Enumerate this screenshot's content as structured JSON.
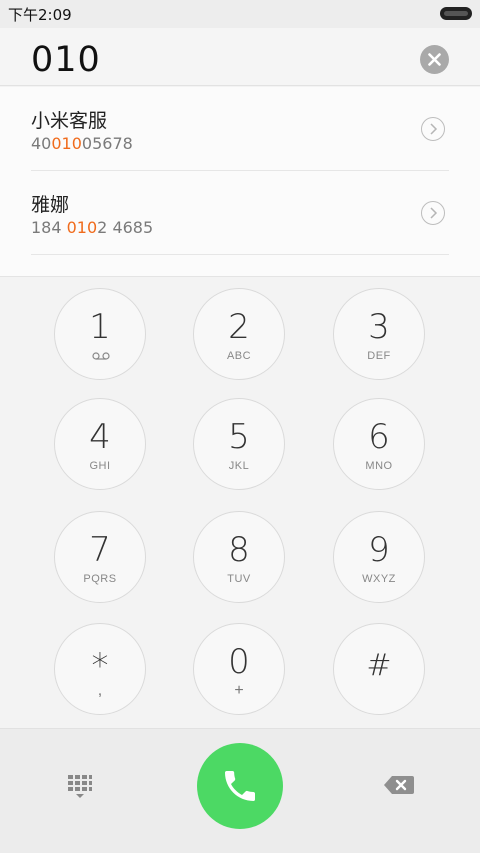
{
  "status_bar": {
    "time": "下午2:09"
  },
  "dialer": {
    "number": "010"
  },
  "results": [
    {
      "name": "小米客服",
      "number_pre": "40",
      "number_match": "010",
      "number_post": "05678"
    },
    {
      "name": "雅娜",
      "number_pre": "184 ",
      "number_match": "010",
      "number_post": "2 4685"
    }
  ],
  "keypad": [
    {
      "digit": "1",
      "letters": "",
      "icon": "voicemail-icon"
    },
    {
      "digit": "2",
      "letters": "ABC"
    },
    {
      "digit": "3",
      "letters": "DEF"
    },
    {
      "digit": "4",
      "letters": "GHI"
    },
    {
      "digit": "5",
      "letters": "JKL"
    },
    {
      "digit": "6",
      "letters": "MNO"
    },
    {
      "digit": "7",
      "letters": "PQRS"
    },
    {
      "digit": "8",
      "letters": "TUV"
    },
    {
      "digit": "9",
      "letters": "WXYZ"
    },
    {
      "digit": "*",
      "letters": ","
    },
    {
      "digit": "0",
      "letters": "+"
    },
    {
      "digit": "#",
      "letters": ""
    }
  ],
  "colors": {
    "highlight": "#f06b1c",
    "call_green": "#4cd964"
  },
  "icons": {
    "clear": "clear-icon",
    "detail": "chevron-right-icon",
    "dialpad": "dialpad-icon",
    "call": "phone-icon",
    "backspace": "backspace-icon"
  }
}
